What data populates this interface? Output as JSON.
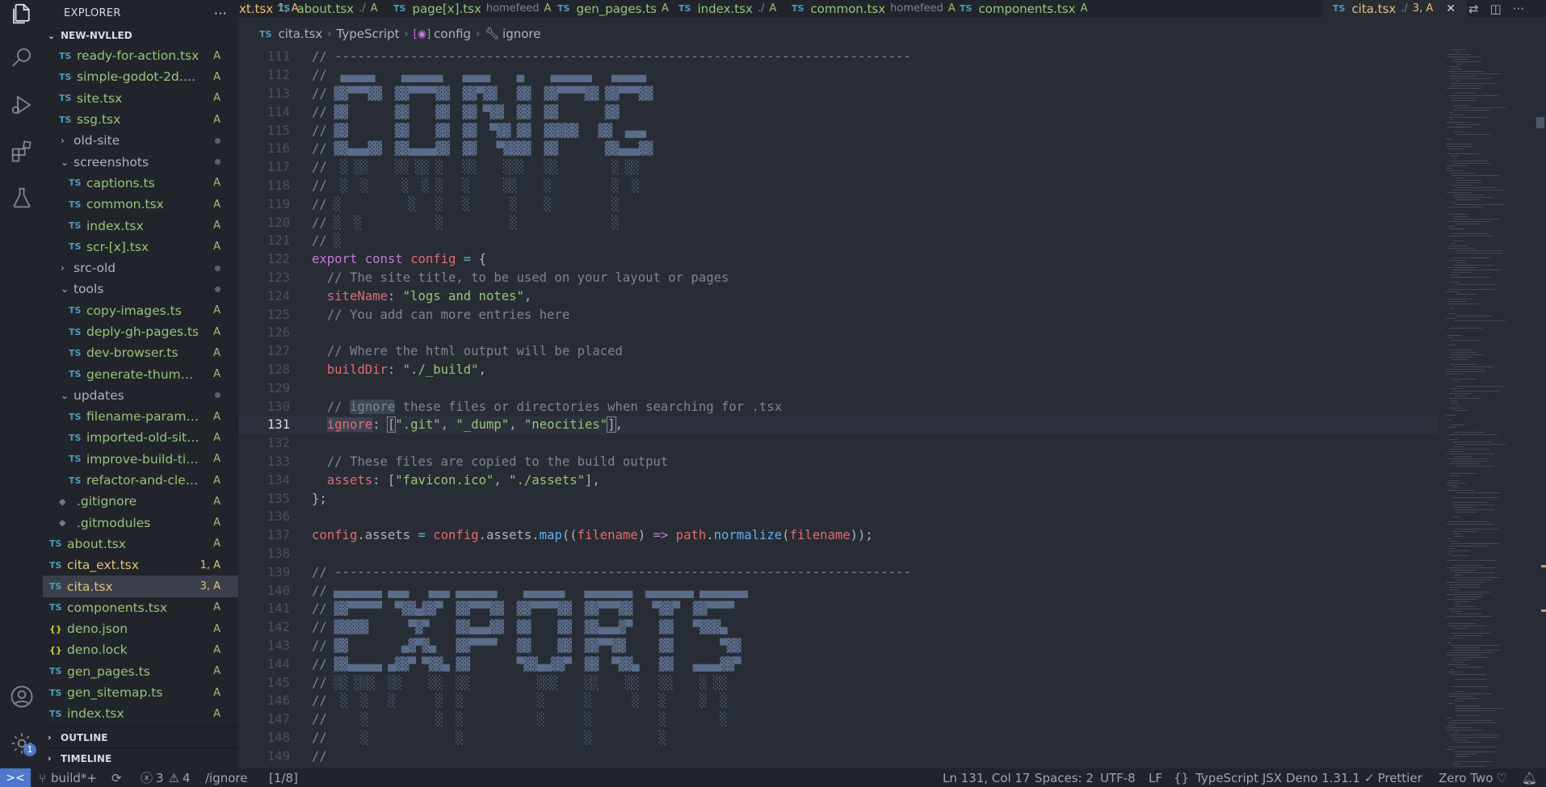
{
  "activity_bar": {
    "icons": [
      "files-icon",
      "search-icon",
      "run-debug-icon",
      "extensions-icon",
      "testing-icon"
    ],
    "bottom_icons": [
      "account-icon",
      "settings-gear-icon"
    ],
    "settings_badge": "1"
  },
  "sidebar": {
    "title": "EXPLORER",
    "more": "···",
    "root_folder": "NEW-NVLLED",
    "tree": [
      {
        "kind": "file",
        "type": "TS",
        "name": "ready-for-action.tsx",
        "status": "A",
        "indent": 1
      },
      {
        "kind": "file",
        "type": "TS",
        "name": "simple-godot-2d.tsx",
        "status": "A",
        "indent": 1
      },
      {
        "kind": "file",
        "type": "TS",
        "name": "site.tsx",
        "status": "A",
        "indent": 1
      },
      {
        "kind": "file",
        "type": "TS",
        "name": "ssg.tsx",
        "status": "A",
        "indent": 1
      },
      {
        "kind": "folder",
        "open": false,
        "name": "old-site",
        "status": "dot",
        "indent": 1
      },
      {
        "kind": "folder",
        "open": true,
        "name": "screenshots",
        "status": "dot",
        "indent": 1
      },
      {
        "kind": "file",
        "type": "TS",
        "name": "captions.ts",
        "status": "A",
        "indent": 2
      },
      {
        "kind": "file",
        "type": "TS",
        "name": "common.tsx",
        "status": "A",
        "indent": 2
      },
      {
        "kind": "file",
        "type": "TS",
        "name": "index.tsx",
        "status": "A",
        "indent": 2
      },
      {
        "kind": "file",
        "type": "TS",
        "name": "scr-[x].tsx",
        "status": "A",
        "indent": 2
      },
      {
        "kind": "folder",
        "open": false,
        "name": "src-old",
        "status": "dot",
        "indent": 1
      },
      {
        "kind": "folder",
        "open": true,
        "name": "tools",
        "status": "dot",
        "indent": 1
      },
      {
        "kind": "file",
        "type": "TS",
        "name": "copy-images.ts",
        "status": "A",
        "indent": 2
      },
      {
        "kind": "file",
        "type": "TS",
        "name": "deply-gh-pages.ts",
        "status": "A",
        "indent": 2
      },
      {
        "kind": "file",
        "type": "TS",
        "name": "dev-browser.ts",
        "status": "A",
        "indent": 2
      },
      {
        "kind": "file",
        "type": "TS",
        "name": "generate-thumbna...",
        "status": "A",
        "indent": 2
      },
      {
        "kind": "folder",
        "open": true,
        "name": "updates",
        "status": "dot",
        "indent": 1
      },
      {
        "kind": "file",
        "type": "TS",
        "name": "filename-params.tsx",
        "status": "A",
        "indent": 2
      },
      {
        "kind": "file",
        "type": "TS",
        "name": "imported-old-site.tsx",
        "status": "A",
        "indent": 2
      },
      {
        "kind": "file",
        "type": "TS",
        "name": "improve-build-time...",
        "status": "A",
        "indent": 2
      },
      {
        "kind": "file",
        "type": "TS",
        "name": "refactor-and-clean...",
        "status": "A",
        "indent": 2
      },
      {
        "kind": "file",
        "type": "GIT",
        "name": ".gitignore",
        "status": "A",
        "indent": 1
      },
      {
        "kind": "file",
        "type": "GIT",
        "name": ".gitmodules",
        "status": "A",
        "indent": 1
      },
      {
        "kind": "file",
        "type": "TS",
        "name": "about.tsx",
        "status": "A",
        "indent": 0
      },
      {
        "kind": "file",
        "type": "TS",
        "name": "cita_ext.tsx",
        "status": "1, A",
        "err": true,
        "indent": 0
      },
      {
        "kind": "file",
        "type": "TS",
        "name": "cita.tsx",
        "status": "3, A",
        "err": true,
        "selected": true,
        "indent": 0
      },
      {
        "kind": "file",
        "type": "TS",
        "name": "components.tsx",
        "status": "A",
        "indent": 0
      },
      {
        "kind": "file",
        "type": "JSON",
        "name": "deno.json",
        "status": "A",
        "indent": 0
      },
      {
        "kind": "file",
        "type": "JSON",
        "name": "deno.lock",
        "status": "A",
        "indent": 0
      },
      {
        "kind": "file",
        "type": "TS",
        "name": "gen_pages.ts",
        "status": "A",
        "indent": 0
      },
      {
        "kind": "file",
        "type": "TS",
        "name": "gen_sitemap.ts",
        "status": "A",
        "indent": 0
      },
      {
        "kind": "file",
        "type": "TS",
        "name": "index.tsx",
        "status": "A",
        "indent": 0
      }
    ],
    "outline_label": "OUTLINE",
    "timeline_label": "TIMELINE"
  },
  "tabs": [
    {
      "name": "xt.tsx",
      "desc": "",
      "status": "1, A",
      "err": true
    },
    {
      "name": "about.tsx",
      "desc": "./",
      "status": "A"
    },
    {
      "name": "page[x].tsx",
      "desc": "homefeed",
      "status": "A"
    },
    {
      "name": "gen_pages.ts",
      "desc": "",
      "status": "A"
    },
    {
      "name": "index.tsx",
      "desc": "./",
      "status": "A"
    },
    {
      "name": "common.tsx",
      "desc": "homefeed",
      "status": "A"
    },
    {
      "name": "components.tsx",
      "desc": "",
      "status": "A"
    },
    {
      "name": "cita.tsx",
      "desc": "./",
      "status": "3, A",
      "active": true
    }
  ],
  "breadcrumb": {
    "file": "cita.tsx",
    "lang": "TypeScript",
    "symbol1": "config",
    "symbol2": "ignore"
  },
  "editor": {
    "first_line": 111,
    "current_line": 131,
    "lines": [
      {
        "kind": "rule"
      },
      {
        "kind": "art1",
        "row": 0
      },
      {
        "kind": "art1",
        "row": 1
      },
      {
        "kind": "art1",
        "row": 2
      },
      {
        "kind": "art1",
        "row": 3
      },
      {
        "kind": "art1",
        "row": 4
      },
      {
        "kind": "art1",
        "row": 5
      },
      {
        "kind": "art1",
        "row": 6
      },
      {
        "kind": "art1",
        "row": 7
      },
      {
        "kind": "art1",
        "row": 8
      },
      {
        "kind": "art1",
        "row": 9
      },
      {
        "kind": "tokens",
        "t": [
          [
            "k",
            "export "
          ],
          [
            "k",
            "const "
          ],
          [
            "v",
            "config"
          ],
          [
            "o",
            " = "
          ],
          [
            "",
            "{"
          ]
        ]
      },
      {
        "kind": "tokens",
        "t": [
          [
            "",
            "  "
          ],
          [
            "c",
            "// The site title, to be used on your layout or pages"
          ]
        ]
      },
      {
        "kind": "tokens",
        "t": [
          [
            "",
            "  "
          ],
          [
            "p",
            "siteName"
          ],
          [
            "",
            ": "
          ],
          [
            "s",
            "\"logs and notes\""
          ],
          [
            "",
            ","
          ]
        ]
      },
      {
        "kind": "tokens",
        "t": [
          [
            "",
            "  "
          ],
          [
            "c",
            "// You add can more entries here"
          ]
        ]
      },
      {
        "kind": "tokens",
        "t": []
      },
      {
        "kind": "tokens",
        "t": [
          [
            "",
            "  "
          ],
          [
            "c",
            "// Where the html output will be placed"
          ]
        ]
      },
      {
        "kind": "tokens",
        "t": [
          [
            "",
            "  "
          ],
          [
            "p",
            "buildDir"
          ],
          [
            "",
            ": "
          ],
          [
            "s",
            "\"./_build\""
          ],
          [
            "",
            ","
          ]
        ]
      },
      {
        "kind": "tokens",
        "t": []
      },
      {
        "kind": "tokens",
        "t": [
          [
            "",
            "  "
          ],
          [
            "c",
            "// "
          ],
          [
            "c hl",
            "ignore"
          ],
          [
            "c",
            " these files or directories when searching for .tsx"
          ]
        ]
      },
      {
        "kind": "tokens",
        "t": [
          [
            "",
            "  "
          ],
          [
            "p hl",
            "ignore"
          ],
          [
            "",
            ": "
          ],
          [
            "br",
            "["
          ],
          [
            "s",
            "\".git\""
          ],
          [
            "",
            ", "
          ],
          [
            "s",
            "\"_dump\""
          ],
          [
            "",
            ", "
          ],
          [
            "s",
            "\"neocities\""
          ],
          [
            "br",
            "]"
          ],
          [
            "",
            ","
          ]
        ]
      },
      {
        "kind": "tokens",
        "t": []
      },
      {
        "kind": "tokens",
        "t": [
          [
            "",
            "  "
          ],
          [
            "c",
            "// These files are copied to the build output"
          ]
        ]
      },
      {
        "kind": "tokens",
        "t": [
          [
            "",
            "  "
          ],
          [
            "p",
            "assets"
          ],
          [
            "",
            ": ["
          ],
          [
            "s",
            "\"favicon.ico\""
          ],
          [
            "",
            ", "
          ],
          [
            "s",
            "\"./assets\""
          ],
          [
            "",
            "],"
          ]
        ]
      },
      {
        "kind": "tokens",
        "t": [
          [
            "",
            "};"
          ]
        ]
      },
      {
        "kind": "tokens",
        "t": []
      },
      {
        "kind": "tokens",
        "t": [
          [
            "v",
            "config"
          ],
          [
            "",
            ".assets "
          ],
          [
            "o",
            "="
          ],
          [
            "v",
            " config"
          ],
          [
            "",
            ".assets."
          ],
          [
            "f",
            "map"
          ],
          [
            "",
            "(("
          ],
          [
            "v",
            "filename"
          ],
          [
            "",
            ") "
          ],
          [
            "k",
            "=>"
          ],
          [
            "v",
            " path"
          ],
          [
            "",
            "."
          ],
          [
            "f",
            "normalize"
          ],
          [
            "",
            "("
          ],
          [
            "v",
            "filename"
          ],
          [
            "",
            "));"
          ]
        ]
      },
      {
        "kind": "tokens",
        "t": []
      },
      {
        "kind": "rule"
      },
      {
        "kind": "art2",
        "row": 0
      },
      {
        "kind": "art2",
        "row": 1
      },
      {
        "kind": "art2",
        "row": 2
      },
      {
        "kind": "art2",
        "row": 3
      },
      {
        "kind": "art2",
        "row": 4
      },
      {
        "kind": "art2",
        "row": 5
      },
      {
        "kind": "art2",
        "row": 6
      },
      {
        "kind": "art2",
        "row": 7
      },
      {
        "kind": "art2",
        "row": 8
      },
      {
        "kind": "art2",
        "row": 9
      }
    ],
    "art1": [
      "  ▄▄▄▄▄    ▄▄▄▄▄▄   ▄▄▄▄    ▄    ▄▄▄▄▄▄   ▄▄▄▄▄",
      " ▓▓▀▀▀▓▓  ▓▓▀▀▀▀▓▓  ▓▓▀▓▓   ▓▓  ▓▓▀▀▀▀▓▓ ▓▓▀▀▀▓▓",
      " ▓▓       ▓▓    ▓▓  ▓▓ ▀▓▓  ▓▓  ▓▓       ▓▓",
      " ▓▓       ▓▓    ▓▓  ▓▓  ▀▓▓ ▓▓  ▓▓▓▓▓   ▓▓  ▄▄▄",
      " ▓▓▄▄▄▓▓  ▓▓▄▄▄▄▓▓  ▓▓   ▀▓▓▓▓  ▓▓       ▓▓▄▄▄▓▓",
      "  ░ ░░    ░░ ░░ ░   ░░    ░░░   ░░        ░ ░░",
      "  ░  ░     ░  ░ ░   ░     ░░    ░         ░  ░",
      " ░          ░   ░   ░      ░    ░         ░",
      " ░  ░           ░          ░              ░",
      " ░"
    ],
    "art2": [
      " ▄▄▄▄▄▄▄ ▄▄▄   ▄▄▄ ▄▄▄▄▄▄    ▄▄▄▄▄▄   ▄▄▄▄▄▄▄  ▄▄▄▄▄▄▄ ▄▄▄▄▄▄▄",
      " ▓▓▀▀▀▀▀  ▀▓▓▄▓▓▀  ▓▓▀▀▀▓▓  ▓▓▀▀▀▀▓▓  ▓▓▀▀▀▓▓   ▀▓▓▀  ▓▓▀▀▀▀",
      " ▓▓▓▓▓      ▀▓▀    ▓▓▄▄▄▓▓  ▓▓    ▓▓  ▓▓▄▄▄▓▀    ▓▓   ▀▓▓▓▄",
      " ▓▓        ▄▓▀▓▄   ▓▓▀▀▀▀   ▓▓    ▓▓  ▓▓▀▀▓▓     ▓▓       ▀▓▓",
      " ▓▓▄▄▄▄▄ ▄▓▓▀ ▀▓▓▄ ▓▓       ▀▓▓▄▄▓▓▀  ▓▓  ▀▓▓▄   ▓▓   ▄▄▄▄▓▓▀",
      " ░░ ░░░  ░░    ░░  ░░          ░░░    ░░    ░░   ░░    ░ ░░",
      "  ░  ░   ░      ░  ░           ░      ░      ░   ░     ░  ░",
      "     ░          ░  ░           ░      ░          ░        ░",
      "     ░             ░                  ░          ░",
      ""
    ]
  },
  "statusbar": {
    "remote": "><",
    "branch": "build*+",
    "sync": "⟳",
    "errors": "3",
    "warnings": "4",
    "search_term": "/ignore",
    "match": "[1/8]",
    "position": "Ln 131, Col 17",
    "spaces": "Spaces: 2",
    "encoding": "UTF-8",
    "eol": "LF",
    "language": "TypeScript JSX",
    "deno": "Deno 1.31.1",
    "prettier": "Prettier",
    "theme": "Zero Two",
    "colors": {
      "accent": "#4d78cc",
      "added": "#98c379",
      "modified": "#e5c07b"
    }
  }
}
